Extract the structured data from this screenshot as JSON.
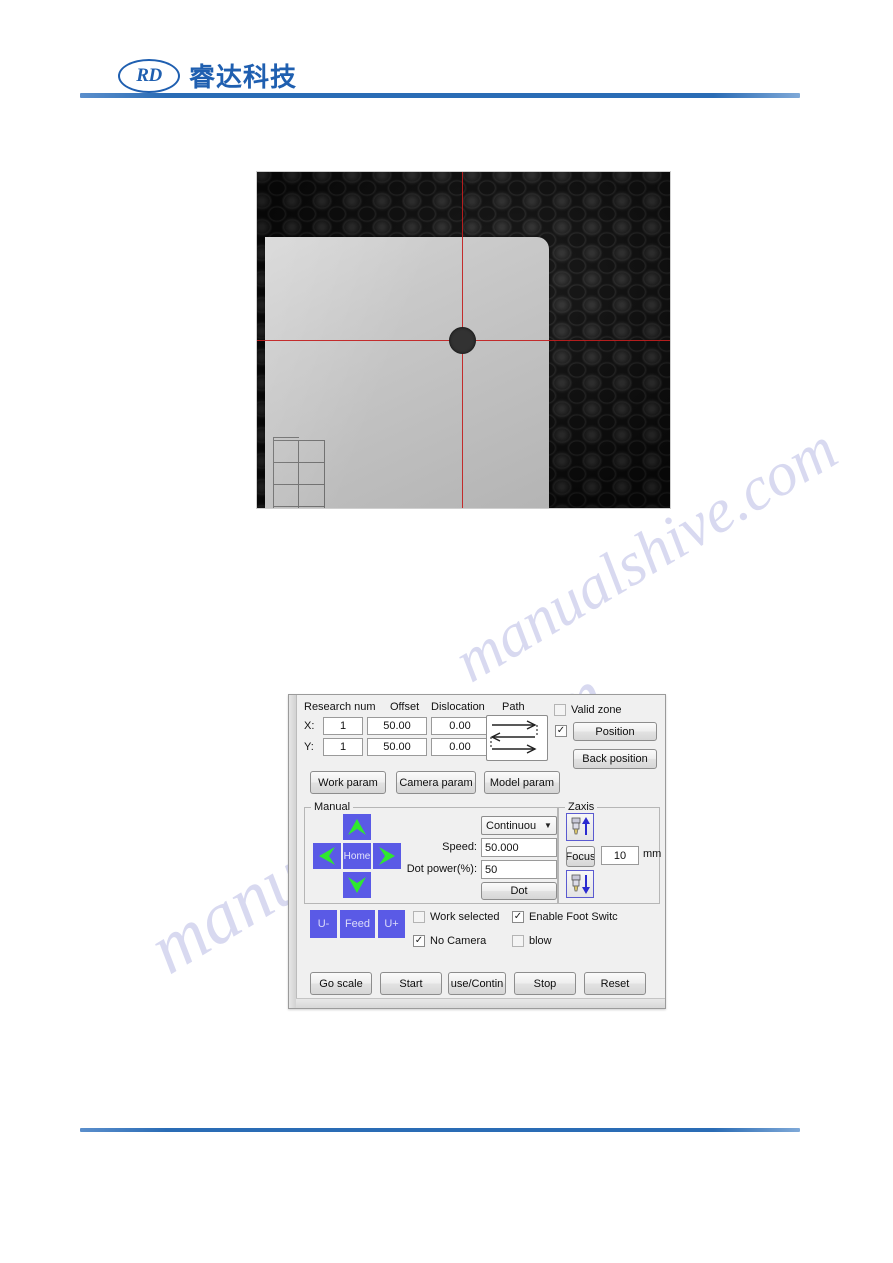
{
  "header": {
    "logo_mark": "RD",
    "logo_text": "睿达科技",
    "logo_color": "#1f5fb0",
    "rule_color": "#2a6cb5"
  },
  "watermark": {
    "line1": "manualshive.com",
    "line2": "manualshive.com"
  },
  "camera_preview": {
    "name": "camera-preview",
    "description": "Grayscale camera view of laser honeycomb bed with white material sheet, red crosshair and dark registration dot",
    "crosshair_color": "#c21e1e",
    "background_color": "#0a0a0a",
    "sheet_color": "#c9c9c9",
    "dot_color": "#323232"
  },
  "panel": {
    "title": "laser-control-panel",
    "accent_blue": "#5a5ae6",
    "arrow_green": "#2fe82f",
    "columns": {
      "research_num": "Research num",
      "offset": "Offset",
      "dislocation": "Dislocation",
      "path": "Path"
    },
    "rows": [
      {
        "axis": "X:",
        "research_num": "1",
        "offset": "50.00",
        "dislocation": "0.00"
      },
      {
        "axis": "Y:",
        "research_num": "1",
        "offset": "50.00",
        "dislocation": "0.00"
      }
    ],
    "path_icon": "zigzag-scan-path-icon",
    "valid_zone": {
      "label": "Valid zone",
      "checked": false,
      "mark": ""
    },
    "position_checkbox": {
      "checked": true,
      "mark": "✓"
    },
    "position_button": "Position",
    "back_position_button": "Back position",
    "param_buttons": {
      "work": "Work param",
      "camera": "Camera param",
      "model": "Model param"
    },
    "manual": {
      "group_label": "Manual",
      "home_button": "Home",
      "up_icon": "arrow-up-icon",
      "down_icon": "arrow-down-icon",
      "left_icon": "arrow-left-icon",
      "right_icon": "arrow-right-icon",
      "mode_select": "Continuou",
      "mode_arrow": "▼",
      "speed_label": "Speed:",
      "speed_value": "50.000",
      "dot_power_label": "Dot power(%):",
      "dot_power_value": "50",
      "dot_button": "Dot"
    },
    "zaxis": {
      "group_label": "Zaxis",
      "up_icon": "laser-head-up-icon",
      "down_icon": "laser-head-down-icon",
      "focus_button": "Focus",
      "value": "10",
      "unit": "mm"
    },
    "u_buttons": {
      "minus": "U-",
      "feed": "Feed",
      "plus": "U+"
    },
    "checkboxes": [
      {
        "label": "Work selected",
        "checked": false,
        "mark": ""
      },
      {
        "label": "Enable Foot Switc",
        "checked": true,
        "mark": "✓"
      },
      {
        "label": "No Camera",
        "checked": true,
        "mark": "✓"
      },
      {
        "label": "blow",
        "checked": false,
        "mark": ""
      }
    ],
    "action_buttons": [
      {
        "label": "Go scale"
      },
      {
        "label": "Start"
      },
      {
        "label": "use/Contin"
      },
      {
        "label": "Stop"
      },
      {
        "label": "Reset"
      }
    ]
  }
}
